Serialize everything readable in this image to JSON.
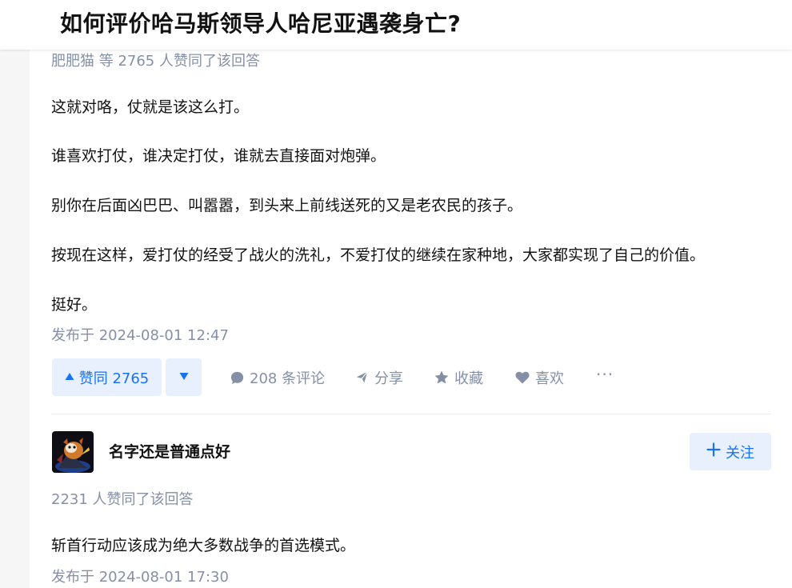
{
  "question": {
    "title": "如何评价哈马斯领导人哈尼亚遇袭身亡?"
  },
  "answer1": {
    "voters_text": "肥肥猫 等 2765 人赞同了该回答",
    "paragraphs": [
      "这就对咯，仗就是该这么打。",
      "谁喜欢打仗，谁决定打仗，谁就去直接面对炮弹。",
      "别你在后面凶巴巴、叫嚣嚣，到头来上前线送死的又是老农民的孩子。",
      "按现在这样，爱打仗的经受了战火的洗礼，不爱打仗的继续在家种地，大家都实现了自己的价值。",
      "挺好。"
    ],
    "published": "发布于 2024-08-01 12:47",
    "actions": {
      "vote_up": "赞同 2765",
      "comments": "208 条评论",
      "share": "分享",
      "favorite": "收藏",
      "like": "喜欢",
      "more": "···"
    }
  },
  "answer2": {
    "author": "名字还是普通点好",
    "follow_label": "关注",
    "voters_text": "2231 人赞同了该回答",
    "paragraphs": [
      "斩首行动应该成为绝大多数战争的首选模式。"
    ],
    "published": "发布于 2024-08-01 17:30"
  },
  "colors": {
    "accent": "#1772f6",
    "accent_bg": "#e8f0fd",
    "muted": "#8590a6"
  },
  "icons": [
    "caret-up-icon",
    "caret-down-icon",
    "comment-icon",
    "share-icon",
    "star-icon",
    "heart-icon",
    "plus-icon"
  ]
}
